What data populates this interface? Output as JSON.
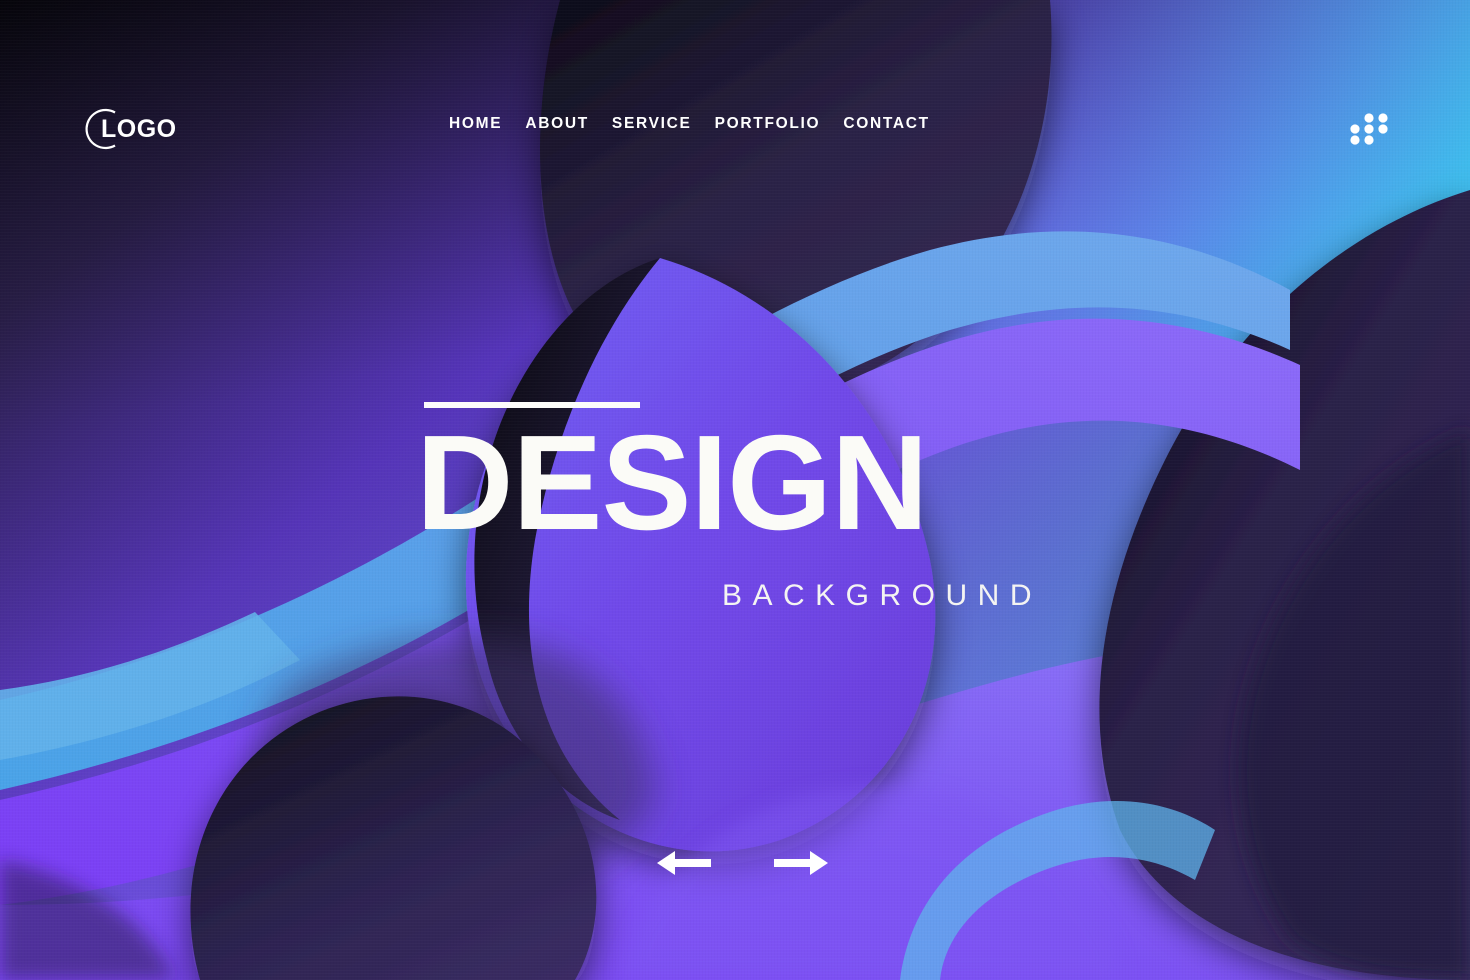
{
  "page": {
    "title": "DESIGN",
    "subtitle": "BACKGROUND"
  },
  "brand": {
    "logo_text": "LOGO",
    "logo_mark": "circle-arc"
  },
  "nav": {
    "items": [
      {
        "label": "HOME",
        "name": "nav-item-home"
      },
      {
        "label": "ABOUT",
        "name": "nav-item-about"
      },
      {
        "label": "SERVICE",
        "name": "nav-item-service"
      },
      {
        "label": "PORTFOLIO",
        "name": "nav-item-portfolio"
      },
      {
        "label": "CONTACT",
        "name": "nav-item-contact"
      }
    ],
    "menu_icon": "dot-grid-icon"
  },
  "slider": {
    "prev_icon": "arrow-left-icon",
    "next_icon": "arrow-right-icon"
  },
  "colors": {
    "text_primary": "#fbfbf7",
    "accent_purple": "#7c4ff0",
    "accent_violet": "#6f3fe0",
    "accent_blue": "#5a9fe8",
    "accent_cyan": "#4bb8e8",
    "dark_navy": "#161326",
    "deep_purple": "#2e2350",
    "bright_purple": "#8050f5"
  }
}
